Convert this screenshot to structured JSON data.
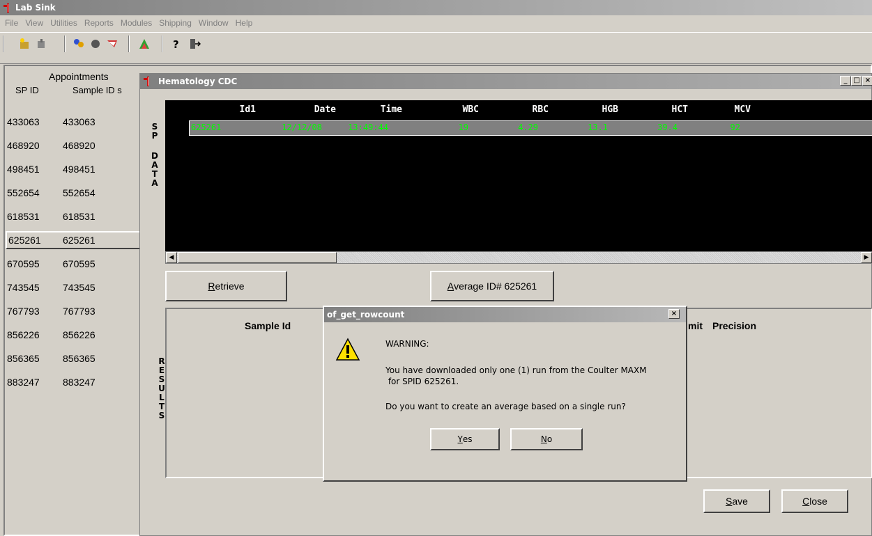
{
  "app": {
    "title": "Lab Sink"
  },
  "menu": [
    "File",
    "View",
    "Utilities",
    "Reports",
    "Modules",
    "Shipping",
    "Window",
    "Help"
  ],
  "toolbar": [
    "new-icon",
    "open-icon",
    "users-icon",
    "hand-icon",
    "flag-icon",
    "chart-icon",
    "help-icon",
    "exit-icon"
  ],
  "appointments": {
    "title": "Appointments",
    "col_spid": "SP ID",
    "col_sample": "Sample ID s",
    "rows": [
      [
        "433063",
        "433063"
      ],
      [
        "468920",
        "468920"
      ],
      [
        "498451",
        "498451"
      ],
      [
        "552654",
        "552654"
      ],
      [
        "618531",
        "618531"
      ],
      [
        "625261",
        "625261"
      ],
      [
        "670595",
        "670595"
      ],
      [
        "743545",
        "743545"
      ],
      [
        "767793",
        "767793"
      ],
      [
        "856226",
        "856226"
      ],
      [
        "856365",
        "856365"
      ],
      [
        "883247",
        "883247"
      ]
    ],
    "selected_index": 5
  },
  "cdc": {
    "title": "Hematology CDC",
    "sp_data_label": "SP DATA",
    "results_label": "RESULTS",
    "columns": [
      "Id1",
      "Date",
      "Time",
      "WBC",
      "RBC",
      "HGB",
      "HCT",
      "MCV"
    ],
    "row": [
      "625261",
      "12/12/08",
      "13:49:44",
      "19",
      "4.29",
      "13.1",
      "39.4",
      "92"
    ],
    "retrieve": "Retrieve",
    "average": "Average ID# 625261",
    "results_sample_id": "Sample Id",
    "results_limit_fragment": "mit",
    "results_precision": "Precision",
    "save": "Save",
    "close": "Close"
  },
  "dialog": {
    "title": "of_get_rowcount",
    "line1": "WARNING:",
    "line2": "You have downloaded only one (1) run from the Coulter MAXM",
    "line3": " for SPID 625261.",
    "line4": "Do you want to create an average based on a single run?",
    "yes": "Yes",
    "no": "No"
  }
}
